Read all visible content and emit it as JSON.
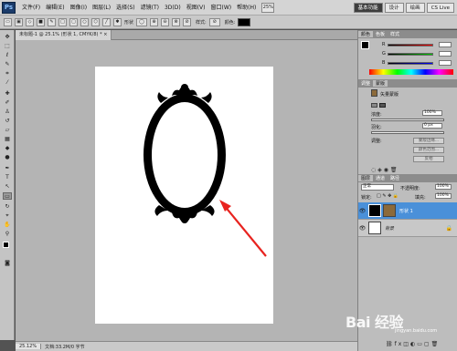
{
  "menubar": {
    "logo": "Ps",
    "menus": [
      "文件(F)",
      "编辑(E)",
      "图像(I)",
      "图层(L)",
      "选择(S)",
      "滤镜(T)",
      "3D(D)",
      "视图(V)",
      "窗口(W)",
      "帮助(H)"
    ],
    "zoom": "25%",
    "workspace_buttons": [
      "基本功能",
      "设计",
      "绘画"
    ],
    "cslive": "CS Live"
  },
  "optbar": {
    "mode_label": "形状",
    "style_label": "样式:",
    "color_label": "颜色:",
    "color": "#000000"
  },
  "document": {
    "tab_title": "未标题-1 @ 25.1% (形状 1, CMYK/8) *",
    "zoom_status": "25.12%",
    "file_status": "文档:33.2M/0 字节"
  },
  "colors": {
    "accent_arrow": "#e8231f",
    "layer_selected": "#4a90d9"
  },
  "panels": {
    "color_tabs": [
      "颜色",
      "色板",
      "样式"
    ],
    "color_channels": [
      "R",
      "G",
      "B"
    ],
    "color_values": [
      "",
      "",
      ""
    ],
    "adjust_tabs": [
      "调整",
      "蒙版"
    ],
    "mask_title": "矢量蒙版",
    "density_label": "浓度:",
    "density_value": "100%",
    "feather_label": "羽化:",
    "feather_value": "0 px",
    "refine_label": "调整:",
    "btn_edge": "蒙版边缘...",
    "btn_color_range": "颜色范围...",
    "btn_invert": "反相",
    "layers_tabs": [
      "图层",
      "通道",
      "路径"
    ],
    "blend_mode": "正常",
    "opacity_label": "不透明度:",
    "opacity_value": "100%",
    "lock_label": "锁定:",
    "fill_label": "填充:",
    "fill_value": "100%",
    "layers": [
      {
        "name": "形状 1",
        "selected": true
      },
      {
        "name": "背景",
        "selected": false
      }
    ]
  },
  "watermark": {
    "text": "Bai 经验",
    "sub": "jingyan.baidu.com"
  }
}
